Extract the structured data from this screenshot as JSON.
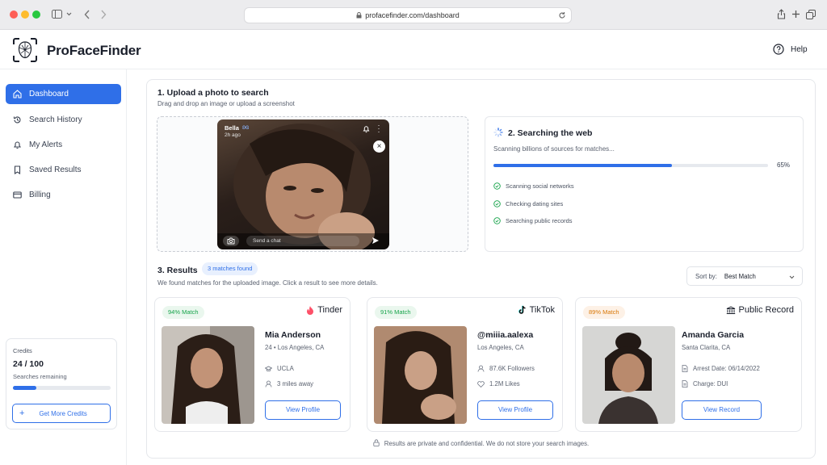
{
  "browser": {
    "url": "profacefinder.com/dashboard"
  },
  "header": {
    "brand": "ProFaceFinder",
    "help_label": "Help"
  },
  "sidebar": {
    "items": [
      {
        "label": "Dashboard",
        "icon": "home-icon"
      },
      {
        "label": "Search History",
        "icon": "history-icon"
      },
      {
        "label": "My Alerts",
        "icon": "bell-icon"
      },
      {
        "label": "Saved Results",
        "icon": "bookmark-icon"
      },
      {
        "label": "Billing",
        "icon": "card-icon"
      }
    ],
    "credits": {
      "title": "Credits",
      "value": "24 / 100",
      "remaining": "Searches remaining",
      "used_fraction": 0.24,
      "button": "Get More Credits"
    }
  },
  "upload": {
    "title": "1. Upload a photo to search",
    "subtitle": "Drag and drop an image or upload a screenshot",
    "story": {
      "user": "Bella",
      "time": "2h ago",
      "chat_placeholder": "Send a chat"
    }
  },
  "searching": {
    "title": "2. Searching the web",
    "subtitle": "Scanning billions of sources for matches...",
    "progress": 65,
    "progress_label": "65%",
    "steps": [
      "Scanning social networks",
      "Checking dating sites",
      "Searching public records"
    ]
  },
  "results": {
    "title": "3. Results",
    "count_badge": "3 matches found",
    "subtitle": "We found matches for the uploaded image. Click a result to see more details.",
    "sort_label": "Sort by:",
    "sort_value": "Best Match",
    "cards": [
      {
        "match": "94% Match",
        "platform": "Tinder",
        "name": "Mia Anderson",
        "line1": "24 • Los Angeles, CA",
        "line2": "UCLA",
        "line3": "3 miles away",
        "button": "View Profile"
      },
      {
        "match": "91% Match",
        "platform": "TikTok",
        "name": "@miiia.aalexa",
        "line1": "Los Angeles, CA",
        "line2": "87.6K Followers",
        "line3": "1.2M Likes",
        "button": "View Profile"
      },
      {
        "match": "89% Match",
        "platform": "Public Record",
        "name": "Amanda Garcia",
        "line1": "Santa Clarita, CA",
        "line2": "Arrest Date: 06/14/2022",
        "line3": "Charge: DUI",
        "button": "View Record"
      }
    ]
  },
  "footer": {
    "privacy": "Results are private and confidential. We do not store your search images."
  },
  "colors": {
    "accent": "#2f6fe8",
    "success": "#16a34a",
    "tinder": "#fd5068",
    "badge_green": "#eaf7ee",
    "badge_orange": "#fdf1e6"
  }
}
